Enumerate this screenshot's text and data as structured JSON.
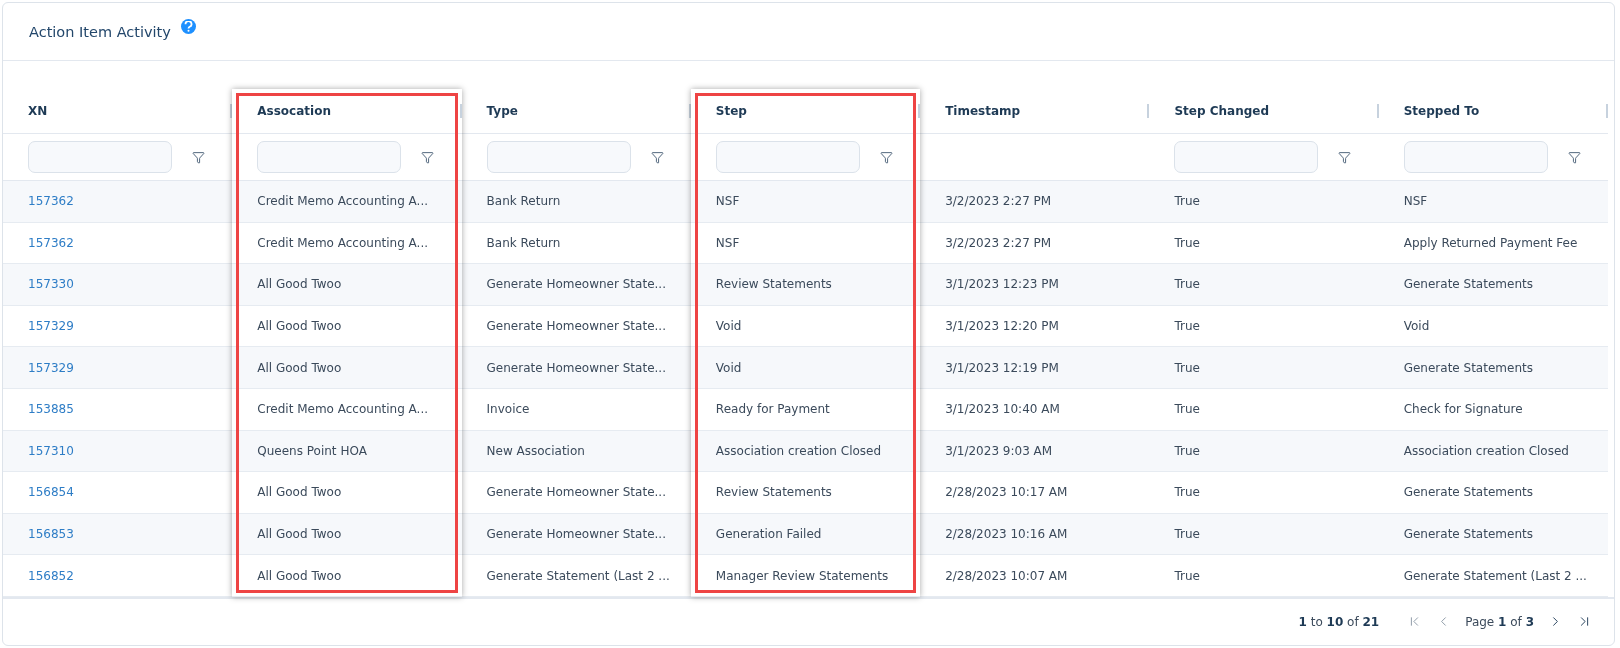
{
  "title": "Action Item Activity",
  "columns": [
    {
      "label": "XN",
      "filter": true,
      "highlighted": false,
      "kind": "link"
    },
    {
      "label": "Assocation",
      "filter": true,
      "highlighted": true,
      "kind": "text"
    },
    {
      "label": "Type",
      "filter": true,
      "highlighted": false,
      "kind": "text"
    },
    {
      "label": "Step",
      "filter": true,
      "highlighted": true,
      "kind": "text"
    },
    {
      "label": "Timestamp",
      "filter": false,
      "highlighted": false,
      "kind": "text"
    },
    {
      "label": "Step Changed",
      "filter": true,
      "highlighted": false,
      "kind": "text"
    },
    {
      "label": "Stepped To",
      "filter": true,
      "highlighted": false,
      "kind": "text"
    }
  ],
  "rows": [
    [
      "157362",
      "Credit Memo Accounting A...",
      "Bank Return",
      "NSF",
      "3/2/2023 2:27 PM",
      "True",
      "NSF"
    ],
    [
      "157362",
      "Credit Memo Accounting A...",
      "Bank Return",
      "NSF",
      "3/2/2023 2:27 PM",
      "True",
      "Apply Returned Payment Fee"
    ],
    [
      "157330",
      "All Good Twoo",
      "Generate Homeowner State...",
      "Review Statements",
      "3/1/2023 12:23 PM",
      "True",
      "Generate Statements"
    ],
    [
      "157329",
      "All Good Twoo",
      "Generate Homeowner State...",
      "Void",
      "3/1/2023 12:20 PM",
      "True",
      "Void"
    ],
    [
      "157329",
      "All Good Twoo",
      "Generate Homeowner State...",
      "Void",
      "3/1/2023 12:19 PM",
      "True",
      "Generate Statements"
    ],
    [
      "153885",
      "Credit Memo Accounting A...",
      "Invoice",
      "Ready for Payment",
      "3/1/2023 10:40 AM",
      "True",
      "Check for Signature"
    ],
    [
      "157310",
      "Queens Point HOA",
      "New Association",
      "Association creation Closed",
      "3/1/2023 9:03 AM",
      "True",
      "Association creation Closed"
    ],
    [
      "156854",
      "All Good Twoo",
      "Generate Homeowner State...",
      "Review Statements",
      "2/28/2023 10:17 AM",
      "True",
      "Generate Statements"
    ],
    [
      "156853",
      "All Good Twoo",
      "Generate Homeowner State...",
      "Generation Failed",
      "2/28/2023 10:16 AM",
      "True",
      "Generate Statements"
    ],
    [
      "156852",
      "All Good Twoo",
      "Generate Statement (Last 2 ...",
      "Manager Review Statements",
      "2/28/2023 10:07 AM",
      "True",
      "Generate Statement (Last 2 ..."
    ]
  ],
  "pagination": {
    "summary": "**1** to **10** of **21**",
    "page": "Page **1** of **3**"
  }
}
